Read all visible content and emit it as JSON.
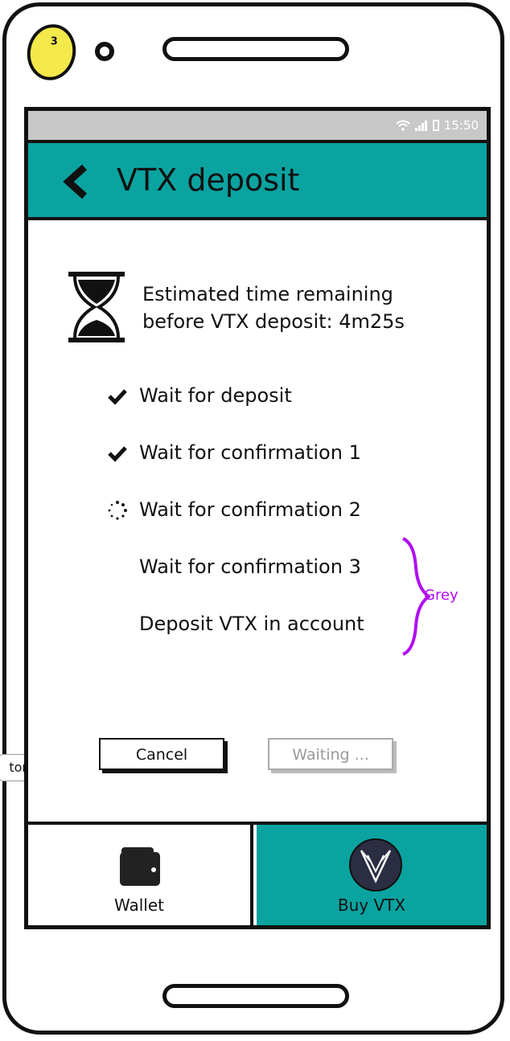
{
  "annotation": {
    "badge": "3",
    "side_tag": "tor",
    "grey_note": "Grey"
  },
  "status_bar": {
    "time": "15:50"
  },
  "app_bar": {
    "title": "VTX deposit"
  },
  "estimate": {
    "line1": "Estimated time remaining",
    "line2": "before VTX deposit: 4m25s"
  },
  "steps": [
    {
      "label": "Wait for deposit",
      "state": "done",
      "icon": "check-icon"
    },
    {
      "label": "Wait for confirmation 1",
      "state": "done",
      "icon": "check-icon"
    },
    {
      "label": "Wait for confirmation 2",
      "state": "in-progress",
      "icon": "spinner-icon"
    },
    {
      "label": "Wait for confirmation 3",
      "state": "pending",
      "icon": ""
    },
    {
      "label": "Deposit VTX in account",
      "state": "pending",
      "icon": ""
    }
  ],
  "buttons": {
    "cancel": "Cancel",
    "waiting": "Waiting ..."
  },
  "tabs": [
    {
      "label": "Wallet",
      "icon": "wallet-icon",
      "active": false
    },
    {
      "label": "Buy VTX",
      "icon": "vtx-logo-icon",
      "active": true
    }
  ],
  "colors": {
    "accent": "#0aa3a0",
    "annotation": "#b10ef2",
    "status_bar": "#c8c8c8"
  }
}
